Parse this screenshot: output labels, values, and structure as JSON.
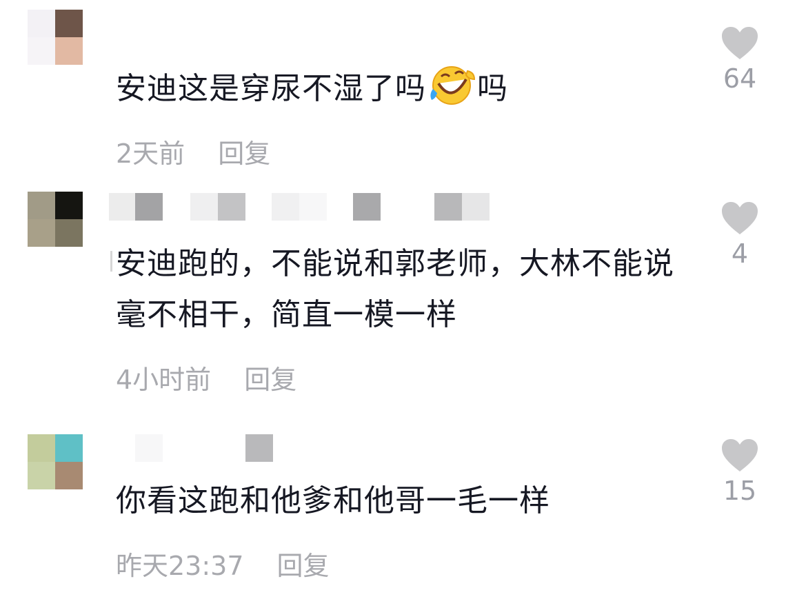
{
  "colors": {
    "text": "#161823",
    "meta": "#a8a9ae",
    "heart": "#c7c7c9"
  },
  "comments": [
    {
      "text_before_emoji": "安迪这是穿尿不湿了吗",
      "emoji": "rolling-on-floor-laughing-emoji",
      "text_after_emoji": "吗",
      "time": "2天前",
      "reply_label": "回复",
      "like_count": "64"
    },
    {
      "text": "安迪跑的，不能说和郭老师，大林不能说毫不相干，简直一模一样",
      "time": "4小时前",
      "reply_label": "回复",
      "like_count": "4"
    },
    {
      "text": "你看这跑和他爹和他哥一毛一样",
      "time": "昨天23:37",
      "reply_label": "回复",
      "like_count": "15"
    }
  ]
}
